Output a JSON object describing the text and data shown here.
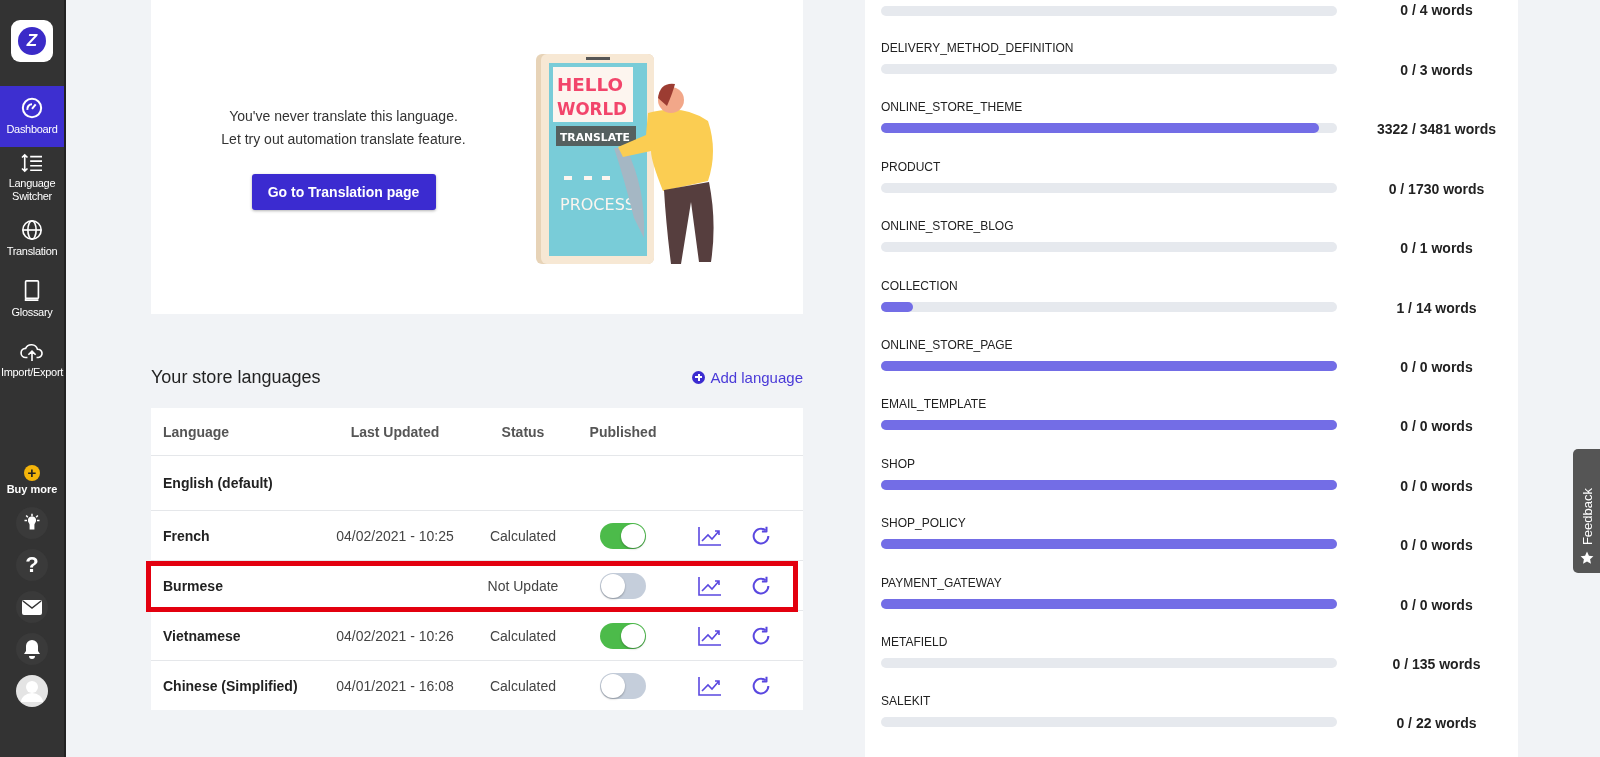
{
  "sidebar": {
    "logo": "Z",
    "items": [
      {
        "label": "Dashboard",
        "selected": true
      },
      {
        "label": "Language Switcher",
        "selected": false
      },
      {
        "label": "Translation",
        "selected": false
      },
      {
        "label": "Glossary",
        "selected": false
      },
      {
        "label": "Import/Export",
        "selected": false
      }
    ],
    "buy_more": {
      "icon": "+",
      "label": "Buy more"
    },
    "help": "?"
  },
  "hero": {
    "message": [
      "You've never translate this language.",
      "Let try out automation translate feature."
    ],
    "button": "Go to Translation page",
    "illustration": {
      "headline": [
        "HELLO",
        "WORLD"
      ],
      "tag": "TRANSLATE",
      "footer": "PROCESS"
    }
  },
  "languages": {
    "title": "Your store languages",
    "add_link": "Add language",
    "columns": [
      "Language",
      "Last Updated",
      "Status",
      "Published"
    ],
    "rows": [
      {
        "language": "English (default)",
        "kind": "default"
      },
      {
        "language": "French",
        "updated": "04/02/2021 - 10:25",
        "status": "Calculated",
        "published": true,
        "highlighted": false,
        "kind": "translated"
      },
      {
        "language": "Burmese",
        "status": "Not Update",
        "published": false,
        "highlighted": true,
        "kind": "translated"
      },
      {
        "language": "Vietnamese",
        "updated": "04/02/2021 - 10:26",
        "status": "Calculated",
        "published": true,
        "highlighted": false,
        "kind": "translated"
      },
      {
        "language": "Chinese (Simplified)",
        "updated": "04/01/2021 - 16:08",
        "status": "Calculated",
        "published": false,
        "highlighted": false,
        "kind": "translated"
      }
    ]
  },
  "resources": [
    {
      "count": "0 / 4 words",
      "level": 0
    },
    {
      "label": "DELIVERY_METHOD_DEFINITION",
      "count": "0 / 3 words",
      "level": 0
    },
    {
      "label": "ONLINE_STORE_THEME",
      "count": "3322 / 3481 words",
      "level": 0.96
    },
    {
      "label": "PRODUCT",
      "count": "0 / 1730 words",
      "level": 0
    },
    {
      "label": "ONLINE_STORE_BLOG",
      "count": "0 / 1 words",
      "level": 0
    },
    {
      "label": "COLLECTION",
      "count": "1 / 14 words",
      "level": 0.07
    },
    {
      "label": "ONLINE_STORE_PAGE",
      "count": "0 / 0 words",
      "level": 1
    },
    {
      "label": "EMAIL_TEMPLATE",
      "count": "0 / 0 words",
      "level": 1
    },
    {
      "label": "SHOP",
      "count": "0 / 0 words",
      "level": 1
    },
    {
      "label": "SHOP_POLICY",
      "count": "0 / 0 words",
      "level": 1
    },
    {
      "label": "PAYMENT_GATEWAY",
      "count": "0 / 0 words",
      "level": 1
    },
    {
      "label": "METAFIELD",
      "count": "0 / 135 words",
      "level": 0
    },
    {
      "label": "SALEKIT",
      "count": "0 / 22 words",
      "level": 0
    }
  ],
  "feedback": {
    "label": "Feedback"
  }
}
